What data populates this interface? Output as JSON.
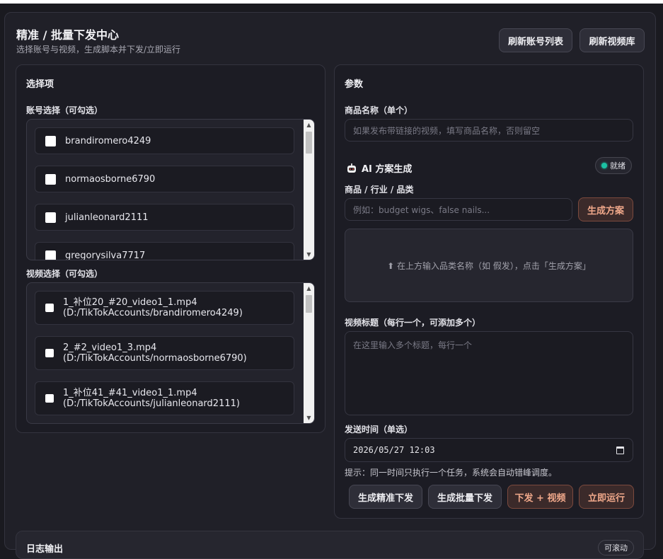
{
  "header": {
    "title": "精准 / 批量下发中心",
    "subtitle": "选择账号与视频，生成脚本并下发/立即运行",
    "refresh_accounts": "刷新账号列表",
    "refresh_videos": "刷新视频库"
  },
  "selection": {
    "title": "选择项",
    "accounts_label": "账号选择（可勾选）",
    "accounts": [
      {
        "name": "brandiromero4249"
      },
      {
        "name": "normaosborne6790"
      },
      {
        "name": "julianleonard2111"
      },
      {
        "name": "gregorysilva7717"
      }
    ],
    "videos_label": "视频选择（可勾选）",
    "videos": [
      {
        "file": "1_补位20_#20_video1_1.mp4",
        "path": "(D:/TikTokAccounts/brandiromero4249)"
      },
      {
        "file": "2_#2_video1_3.mp4",
        "path": "(D:/TikTokAccounts/normaosborne6790)"
      },
      {
        "file": "1_补位41_#41_video1_1.mp4",
        "path": "(D:/TikTokAccounts/julianleonard2111)"
      }
    ]
  },
  "params": {
    "title": "参数",
    "product_label": "商品名称（单个）",
    "product_placeholder": "如果发布带链接的视频，填写商品名称，否则留空",
    "ai_title": "AI 方案生成",
    "ai_status": "就绪",
    "category_label": "商品 / 行业 / 品类",
    "category_placeholder": "例如：budget wigs、false nails...",
    "generate_plan": "生成方案",
    "ai_placeholder": "⬆ 在上方输入品类名称（如 假发），点击「生成方案」",
    "titles_label": "视频标题（每行一个，可添加多个）",
    "titles_placeholder": "在这里输入多个标题，每行一个",
    "time_label": "发送时间（单选）",
    "time_value": "2026/05/27 12:03",
    "hint": "提示：同一时间只执行一个任务，系统会自动错峰调度。",
    "btn_precise": "生成精准下发",
    "btn_batch": "生成批量下发",
    "btn_dispatch_video": "下发 + 视频",
    "btn_run_now": "立即运行"
  },
  "log": {
    "title": "日志输出",
    "badge": "可滚动"
  },
  "colors": {
    "accent": "#f0a88a",
    "status_ok": "#1bc2a3"
  }
}
